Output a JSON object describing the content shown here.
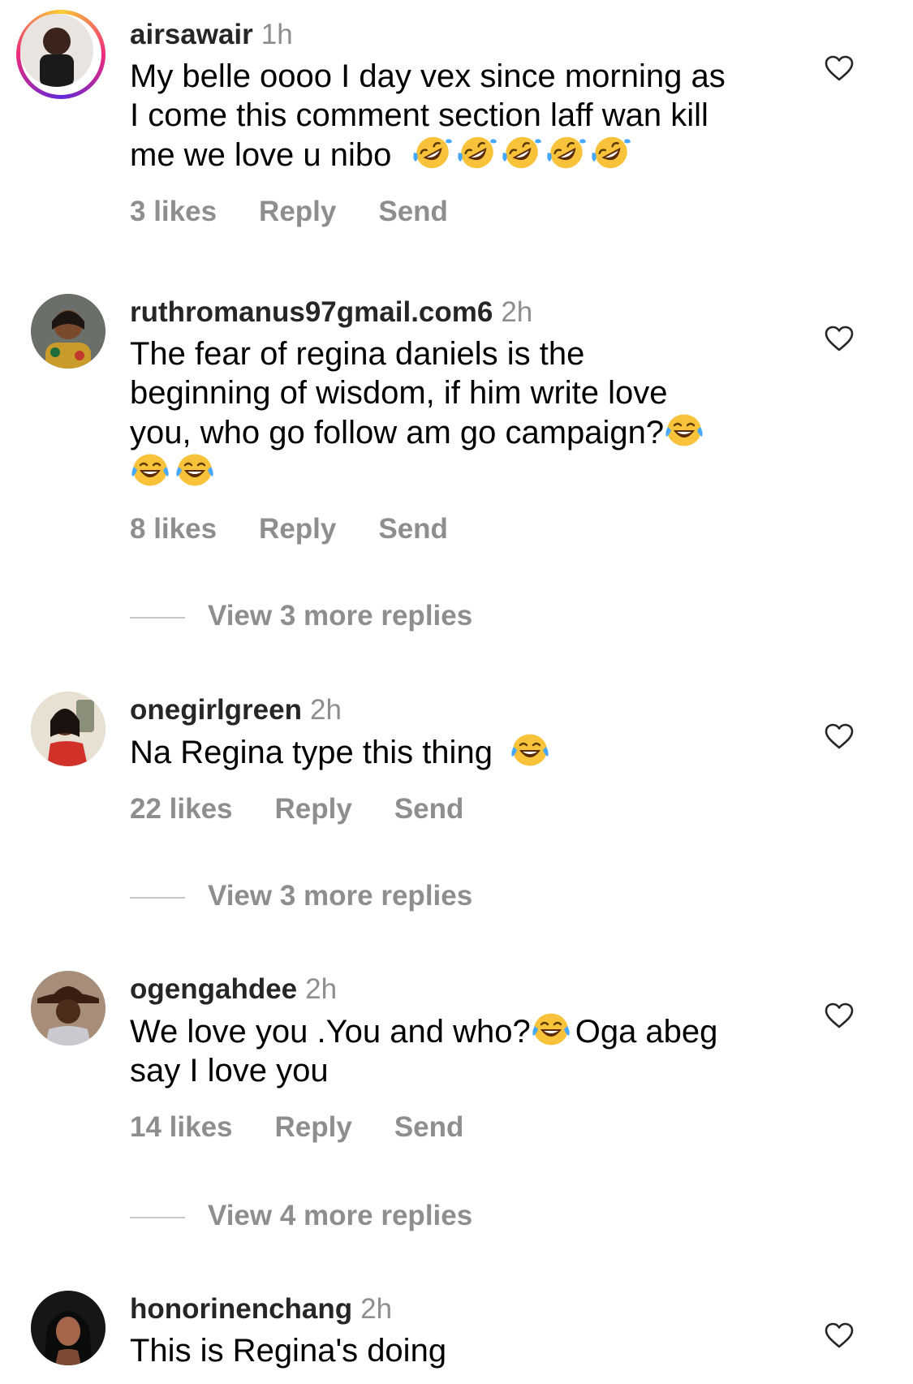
{
  "comments": [
    {
      "username": "airsawair",
      "time": "1h",
      "text_lines": [
        "My belle oooo I day vex since morning as",
        "I come this comment section laff wan kill",
        "me we love u nibo"
      ],
      "emoji": "rolling-on-floor-laughing",
      "emoji_count": 5,
      "likes": "3 likes",
      "reply": "Reply",
      "send": "Send"
    },
    {
      "username": "ruthromanus97gmail.com6",
      "time": "2h",
      "text_lines": [
        "The fear of regina daniels is the",
        "beginning of wisdom, if him write love",
        "you,  who go follow am go campaign?"
      ],
      "likes": "8 likes",
      "reply": "Reply",
      "send": "Send",
      "view_more": "View 3 more replies"
    },
    {
      "username": "onegirlgreen",
      "time": "2h",
      "text": "Na Regina type this thing",
      "likes": "22 likes",
      "reply": "Reply",
      "send": "Send",
      "view_more": "View 3 more replies"
    },
    {
      "username": "ogengahdee",
      "time": "2h",
      "text_a": "We love you .You and who?",
      "text_b": "Oga abeg",
      "text_c": "say I love you",
      "likes": "14 likes",
      "reply": "Reply",
      "send": "Send",
      "view_more": "View 4 more replies"
    },
    {
      "username": "honorinenchang",
      "time": "2h",
      "text": "This is Regina's doing"
    }
  ],
  "icons": {
    "like": "heart-outline-icon",
    "laugh": "face-with-tears-of-joy",
    "rofl": "rolling-on-floor-laughing"
  },
  "colors": {
    "text": "#000000",
    "muted": "#8e8e8e",
    "story_ring": [
      "#f9ce34",
      "#ee2a7b",
      "#6228d7"
    ],
    "emoji_yellow": "#f8c23a"
  }
}
